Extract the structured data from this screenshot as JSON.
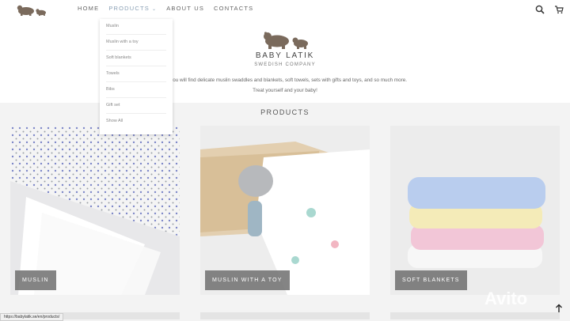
{
  "nav": {
    "home": "HOME",
    "products": "PRODUCTS",
    "about": "ABOUT US",
    "contacts": "CONTACTS"
  },
  "icons": {
    "search": "search-icon",
    "cart": "cart-icon",
    "scroll_up": "arrow-up-icon"
  },
  "dropdown": {
    "items": [
      "Muslin",
      "Muslin with a toy",
      "Soft blankets",
      "Towels",
      "Bibs",
      "Gift set",
      "Show All"
    ]
  },
  "hero": {
    "brand_name": "BABY LATIK",
    "brand_sub": "SWEDISH COMPANY",
    "text1": "re, you will find delicate muslin swaddles and blankets, soft towels, sets with gifts and toys, and so much more.",
    "text2": "Treat yourself and your baby!"
  },
  "products": {
    "title": "PRODUCTS",
    "cards": [
      "MUSLIN",
      "MUSLIN WITH A TOY",
      "SOFT BLANKETS"
    ]
  },
  "status_url": "https://babylatik.se/en/products/",
  "watermark": "Avito",
  "colors": {
    "accent_nav": "#8aa0b5",
    "brown": "#7a6a5c"
  }
}
